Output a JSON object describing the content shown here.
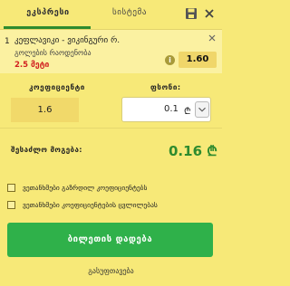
{
  "tabs": {
    "active_label": "ეკსპრესი",
    "system_label": "სისტემა"
  },
  "icons": {
    "save": "save-icon",
    "close": "close-icon",
    "info": "info-icon",
    "chevron": "chevron-down-icon"
  },
  "bet": {
    "number": "1",
    "match": "კეფლავიკი - ვიკინგური რ.",
    "market": "გოლების რაოდენობა",
    "pick": "2.5 მეტი",
    "odds": "1.60",
    "info_glyph": "i"
  },
  "stake_panel": {
    "coef_label": "კოეფიციენტი",
    "stake_label": "ფსონი:",
    "coef_value": "1.6",
    "stake_value": "0.1",
    "currency": "₾",
    "possible_win_label": "შესაძლო მოგება:",
    "possible_win_value": "0.16 ₾"
  },
  "options": {
    "accept_higher": "ვეთანხმები გაზრდილ კოეფიციენტებს",
    "accept_change": "ვეთანხმები კოეფიციენტების ცვლილებას"
  },
  "actions": {
    "place_bet": "ბილეთის დადება",
    "clear": "გასუფთავება"
  },
  "colors": {
    "background": "#f7e978",
    "accent_green": "#2e8b2e",
    "button_green": "#2fb14a",
    "pick_red": "#d12020"
  }
}
